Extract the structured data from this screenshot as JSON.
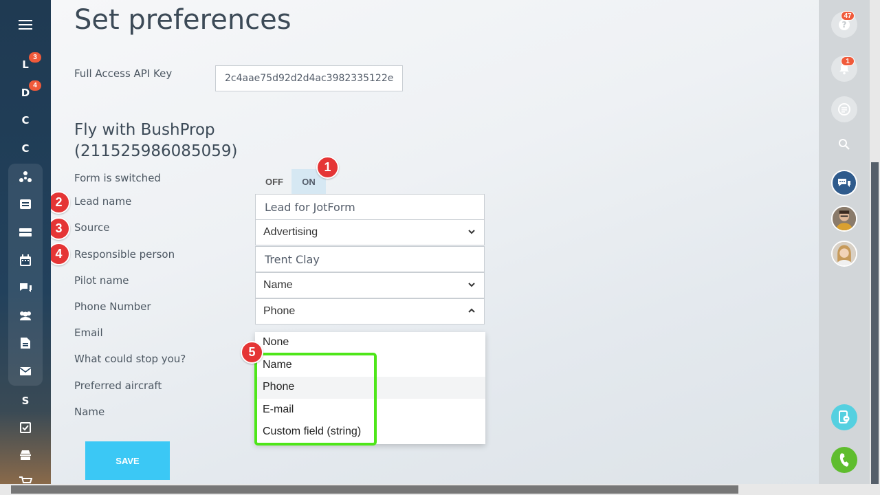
{
  "left_sidebar": {
    "items": [
      {
        "letter": "L",
        "badge": "3"
      },
      {
        "letter": "D",
        "badge": "4"
      },
      {
        "letter": "C",
        "badge": ""
      },
      {
        "letter": "C",
        "badge": ""
      },
      {
        "letter": "S",
        "badge": ""
      }
    ]
  },
  "page": {
    "title": "Set preferences",
    "api_key_label": "Full Access API Key",
    "api_key_value": "2c4aae75d92d2d4ac3982335122e",
    "form_title_line1": "Fly with BushProp",
    "form_title_line2": "(211525986085059)",
    "form_switched_label": "Form is switched",
    "toggle": {
      "off": "OFF",
      "on": "ON",
      "active": "ON"
    },
    "labels": {
      "lead_name": "Lead name",
      "source": "Source",
      "responsible": "Responsible person",
      "pilot": "Pilot name",
      "phone": "Phone Number",
      "email": "Email",
      "stop": "What could stop you?",
      "aircraft": "Preferred aircraft",
      "name": "Name"
    },
    "values": {
      "lead_name": "Lead for JotForm",
      "source": "Advertising",
      "responsible": "Trent Clay",
      "pilot": "Name",
      "phone": "Phone"
    },
    "dropdown_options": [
      "None",
      "Name",
      "Phone",
      "E-mail",
      "Custom field (string)"
    ],
    "save_label": "SAVE"
  },
  "markers": [
    "1",
    "2",
    "3",
    "4",
    "5"
  ],
  "right_bar": {
    "help_badge": "47",
    "notifications_badge": "1"
  },
  "colors": {
    "accent": "#3bc8f5",
    "marker": "#e53535",
    "highlight": "#4ee619",
    "badge": "#f05a3a"
  }
}
